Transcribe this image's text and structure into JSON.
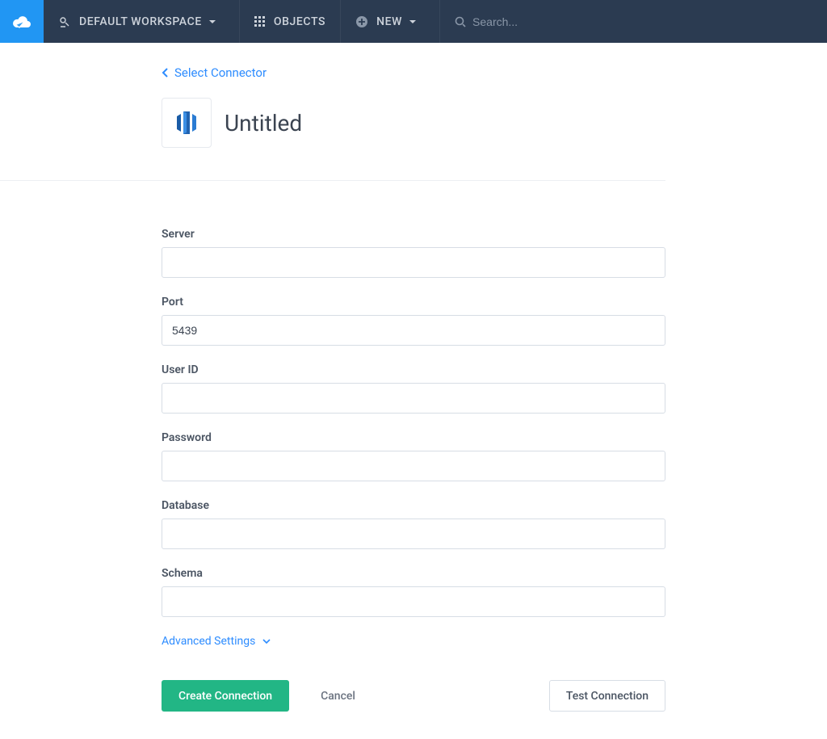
{
  "nav": {
    "workspace_label": "DEFAULT WORKSPACE",
    "objects_label": "OBJECTS",
    "new_label": "NEW",
    "search_placeholder": "Search..."
  },
  "back": {
    "label": "Select Connector"
  },
  "title": "Untitled",
  "fields": {
    "server": {
      "label": "Server",
      "value": ""
    },
    "port": {
      "label": "Port",
      "value": "5439"
    },
    "userid": {
      "label": "User ID",
      "value": ""
    },
    "password": {
      "label": "Password",
      "value": ""
    },
    "database": {
      "label": "Database",
      "value": ""
    },
    "schema": {
      "label": "Schema",
      "value": ""
    }
  },
  "advanced_label": "Advanced Settings",
  "actions": {
    "create": "Create Connection",
    "cancel": "Cancel",
    "test": "Test Connection"
  }
}
